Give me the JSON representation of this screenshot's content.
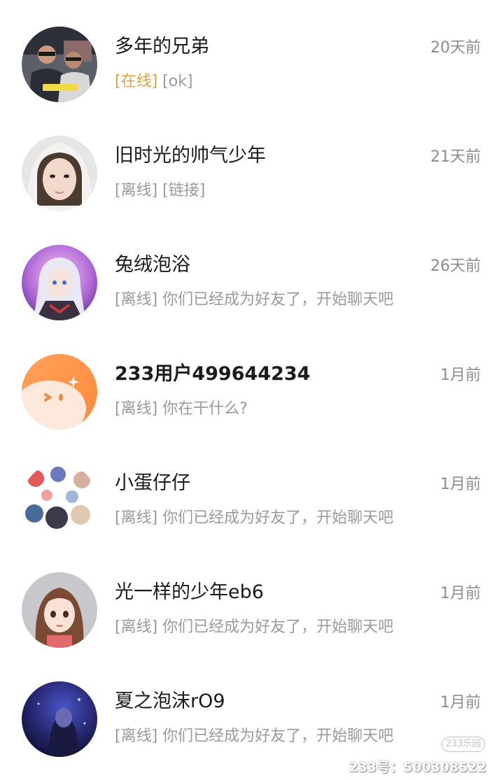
{
  "chats": [
    {
      "name": "多年的兄弟",
      "time": "20天前",
      "status": "[在线]",
      "message": "[ok]",
      "status_color": "#e0a043",
      "avatar": "photo-two-men"
    },
    {
      "name": "旧时光的帅气少年",
      "time": "21天前",
      "status": "[离线]",
      "message": "[链接]",
      "status_color": "#9a9a9a",
      "avatar": "photo-girl-hood"
    },
    {
      "name": "兔绒泡浴",
      "time": "26天前",
      "status": "[离线]",
      "message": "你们已经成为好友了，开始聊天吧",
      "status_color": "#9a9a9a",
      "avatar": "anime-girl-purple"
    },
    {
      "name": "233用户499644234",
      "time": "1月前",
      "status": "[离线]",
      "message": "你在干什么?",
      "status_color": "#9a9a9a",
      "avatar": "default-orange-face"
    },
    {
      "name": "小蛋仔仔",
      "time": "1月前",
      "status": "[离线]",
      "message": "你们已经成为好友了，开始聊天吧",
      "status_color": "#9a9a9a",
      "avatar": "sticker-collage"
    },
    {
      "name": "光一样的少年eb6",
      "time": "1月前",
      "status": "[离线]",
      "message": "你们已经成为好友了，开始聊天吧",
      "status_color": "#9a9a9a",
      "avatar": "anime-girl-brown-hair"
    },
    {
      "name": "夏之泡沫rO9",
      "time": "1月前",
      "status": "[离线]",
      "message": "你们已经成为好友了，开始聊天吧",
      "status_color": "#9a9a9a",
      "avatar": "dark-blue-night"
    }
  ],
  "watermark": {
    "badge": "233乐园",
    "id": "233号：500308522"
  }
}
